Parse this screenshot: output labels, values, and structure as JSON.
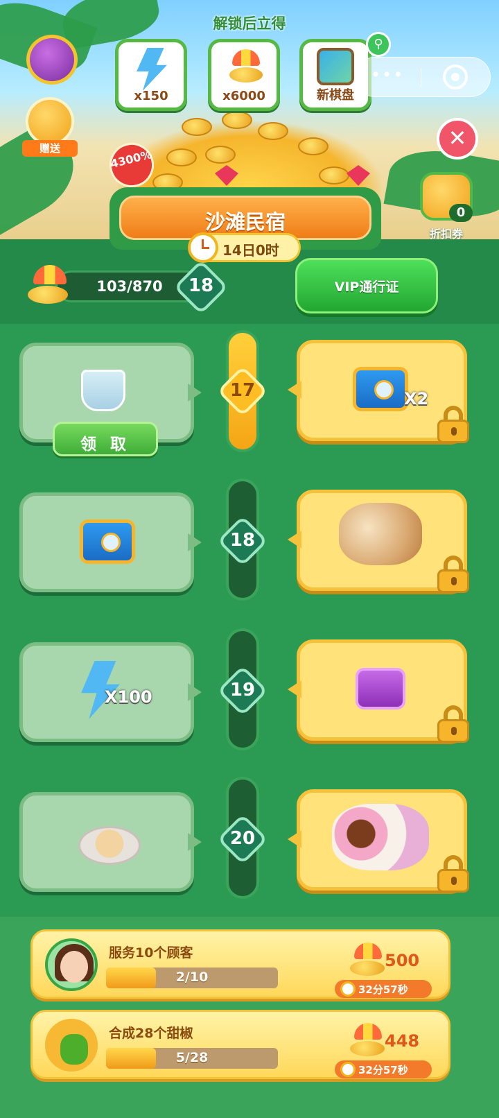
{
  "header": {
    "unlock_title": "解锁后立得",
    "rewards": [
      {
        "label": "x150",
        "icon": "energy-bolt-icon"
      },
      {
        "label": "x6000",
        "icon": "umbrella-coin-icon"
      },
      {
        "label": "新棋盘",
        "icon": "new-board-icon"
      }
    ],
    "gift_label": "赠送",
    "percent_badge": "4300%",
    "coupon": {
      "label": "折扣券",
      "count": "0"
    },
    "capsule": {
      "menu": "•••"
    }
  },
  "event": {
    "title": "沙滩民宿",
    "timer": "14日0时"
  },
  "progress": {
    "points": "103/870",
    "level": "18",
    "vip_button": "VIP通行证"
  },
  "track": {
    "claim_button": "领 取",
    "levels": [
      {
        "level": "17",
        "free": {
          "item": "tea-cup"
        },
        "vip": {
          "item": "blue-chest",
          "mult": "X2"
        },
        "active": true
      },
      {
        "level": "18",
        "free": {
          "item": "blue-chest"
        },
        "vip": {
          "item": "food-set"
        },
        "active": false
      },
      {
        "level": "19",
        "free": {
          "item": "energy-bolt",
          "mult": "X100"
        },
        "vip": {
          "item": "purple-chest"
        },
        "active": false
      },
      {
        "level": "20",
        "free": {
          "item": "food-dish"
        },
        "vip": {
          "item": "sweets-set"
        },
        "active": false
      }
    ]
  },
  "tasks": [
    {
      "name": "服务10个顾客",
      "progress": "2/10",
      "progress_fraction": 0.2,
      "reward": "500",
      "time": "32分57秒"
    },
    {
      "name": "合成28个甜椒",
      "progress": "5/28",
      "progress_fraction": 0.18,
      "reward": "448",
      "time": "32分57秒"
    }
  ],
  "colors": {
    "primary_green": "#2b9a52",
    "vip_gold": "#ffe27a",
    "accent_orange": "#f07d17"
  }
}
